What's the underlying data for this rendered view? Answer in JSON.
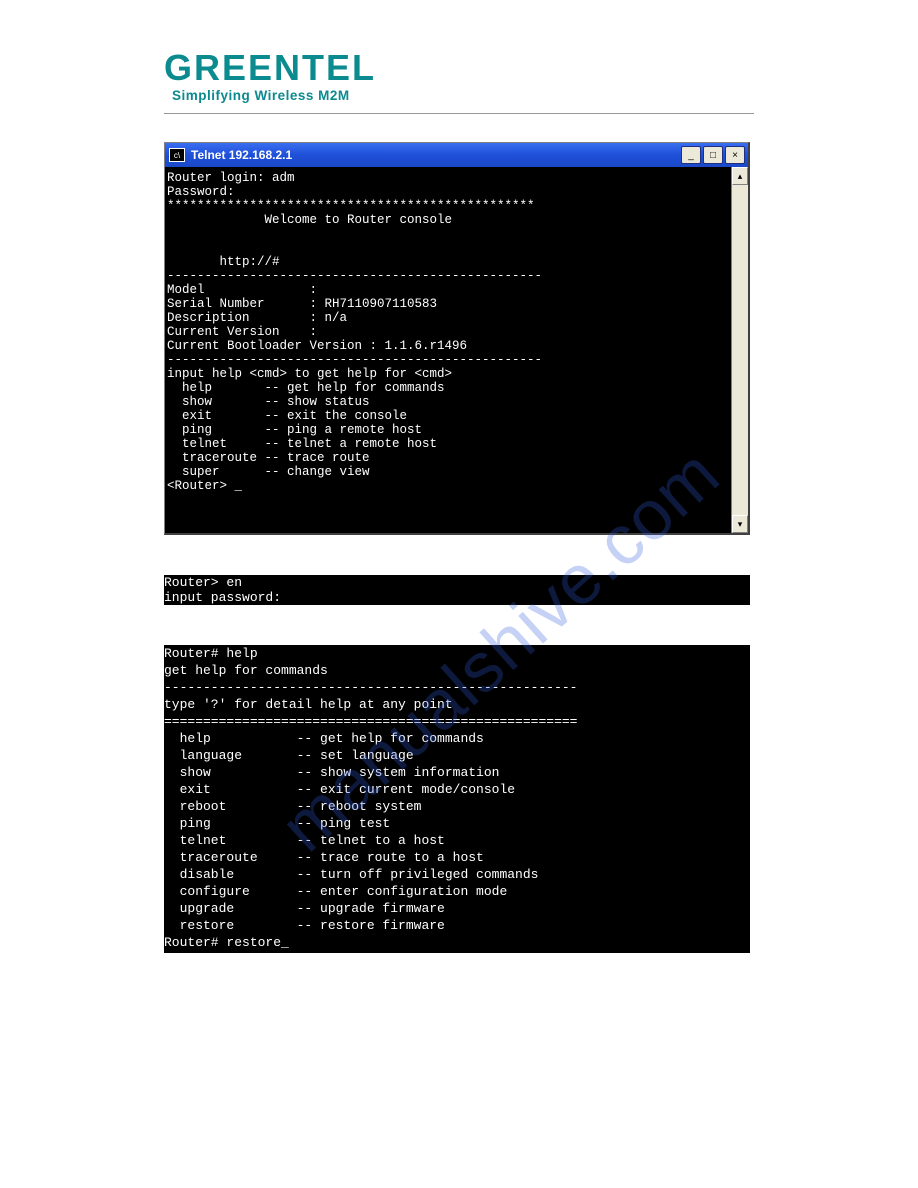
{
  "logo": {
    "main": "GREENTEL",
    "sub": "Simplifying Wireless M2M"
  },
  "window": {
    "title": "Telnet 192.168.2.1",
    "min": "_",
    "max": "□",
    "close": "×",
    "arrow_up": "▴",
    "arrow_down": "▾"
  },
  "terminal1": "Router login: adm\nPassword:\n*************************************************\n             Welcome to Router console\n\n\n       http://#\n--------------------------------------------------\nModel              :\nSerial Number      : RH7110907110583\nDescription        : n/a\nCurrent Version    :\nCurrent Bootloader Version : 1.1.6.r1496\n--------------------------------------------------\ninput help <cmd> to get help for <cmd>\n  help       -- get help for commands\n  show       -- show status\n  exit       -- exit the console\n  ping       -- ping a remote host\n  telnet     -- telnet a remote host\n  traceroute -- trace route\n  super      -- change view\n<Router> _",
  "terminal2": "Router> en\ninput password:",
  "terminal3": "Router# help\nget help for commands\n-----------------------------------------------------\ntype '?' for detail help at any point\n=====================================================\n  help           -- get help for commands\n  language       -- set language\n  show           -- show system information\n  exit           -- exit current mode/console\n  reboot         -- reboot system\n  ping           -- ping test\n  telnet         -- telnet to a host\n  traceroute     -- trace route to a host\n  disable        -- turn off privileged commands\n  configure      -- enter configuration mode\n  upgrade        -- upgrade firmware\n  restore        -- restore firmware\nRouter# restore_",
  "watermark": "manualshive.com"
}
